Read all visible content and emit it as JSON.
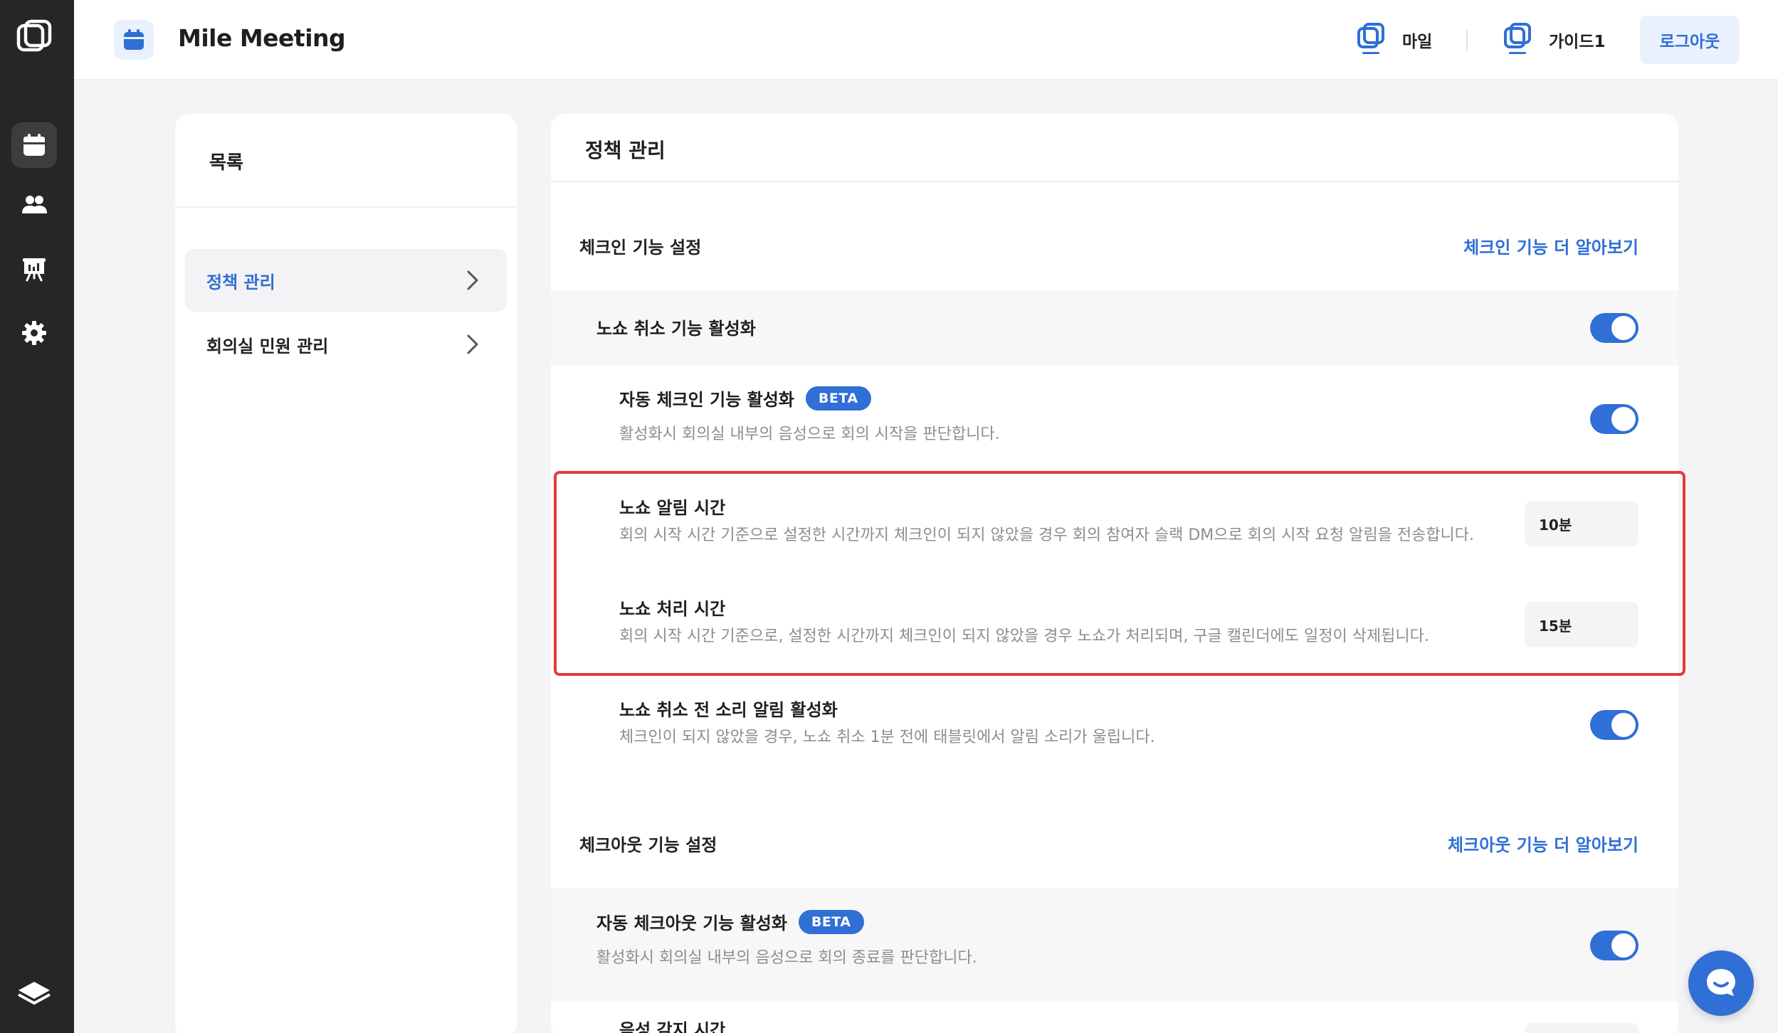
{
  "header": {
    "app_title": "Mile Meeting",
    "workspaces": [
      {
        "label": "마일"
      },
      {
        "label": "가이드1"
      }
    ],
    "logout_label": "로그아웃"
  },
  "rail": {
    "items": [
      {
        "icon": "calendar-icon",
        "active": true
      },
      {
        "icon": "users-icon",
        "active": false
      },
      {
        "icon": "presentation-icon",
        "active": false
      },
      {
        "icon": "gear-icon",
        "active": false
      }
    ],
    "bottom_icon": "layers-icon"
  },
  "sidebar": {
    "title": "목록",
    "items": [
      {
        "label": "정책 관리",
        "active": true
      },
      {
        "label": "회의실 민원 관리",
        "active": false
      }
    ]
  },
  "main": {
    "title": "정책 관리",
    "checkin": {
      "heading": "체크인 기능 설정",
      "link": "체크인 기능 더 알아보기",
      "noshow_cancel": {
        "title": "노쇼 취소 기능 활성화",
        "enabled": true
      },
      "auto_checkin": {
        "title": "자동 체크인 기능 활성화",
        "badge": "BETA",
        "desc": "활성화시 회의실 내부의 음성으로 회의 시작을 판단합니다.",
        "enabled": true
      },
      "noshow_alert": {
        "title": "노쇼 알림 시간",
        "desc": "회의 시작 시간 기준으로 설정한 시간까지 체크인이 되지 않았을 경우 회의 참여자 슬랙 DM으로 회의 시작 요청 알림을 전송합니다.",
        "value": "10분"
      },
      "noshow_process": {
        "title": "노쇼 처리 시간",
        "desc": "회의 시작 시간 기준으로, 설정한 시간까지 체크인이 되지 않았을 경우 노쇼가 처리되며, 구글 캘린더에도 일정이 삭제됩니다.",
        "value": "15분"
      },
      "sound_alert": {
        "title": "노쇼 취소 전 소리 알림 활성화",
        "desc": "체크인이 되지 않았을 경우, 노쇼 취소 1분 전에 태블릿에서 알림 소리가 울립니다.",
        "enabled": true
      }
    },
    "checkout": {
      "heading": "체크아웃 기능 설정",
      "link": "체크아웃 기능 더 알아보기",
      "auto_checkout": {
        "title": "자동 체크아웃 기능 활성화",
        "badge": "BETA",
        "desc": "활성화시 회의실 내부의 음성으로 회의 종료를 판단합니다.",
        "enabled": true
      },
      "voice_detect": {
        "title": "음성 감지 시간"
      }
    }
  },
  "colors": {
    "accent": "#2f6fd6",
    "rail_bg": "#262626",
    "highlight": "#e23b3b"
  },
  "chat_icon": "chat-bubble-icon"
}
